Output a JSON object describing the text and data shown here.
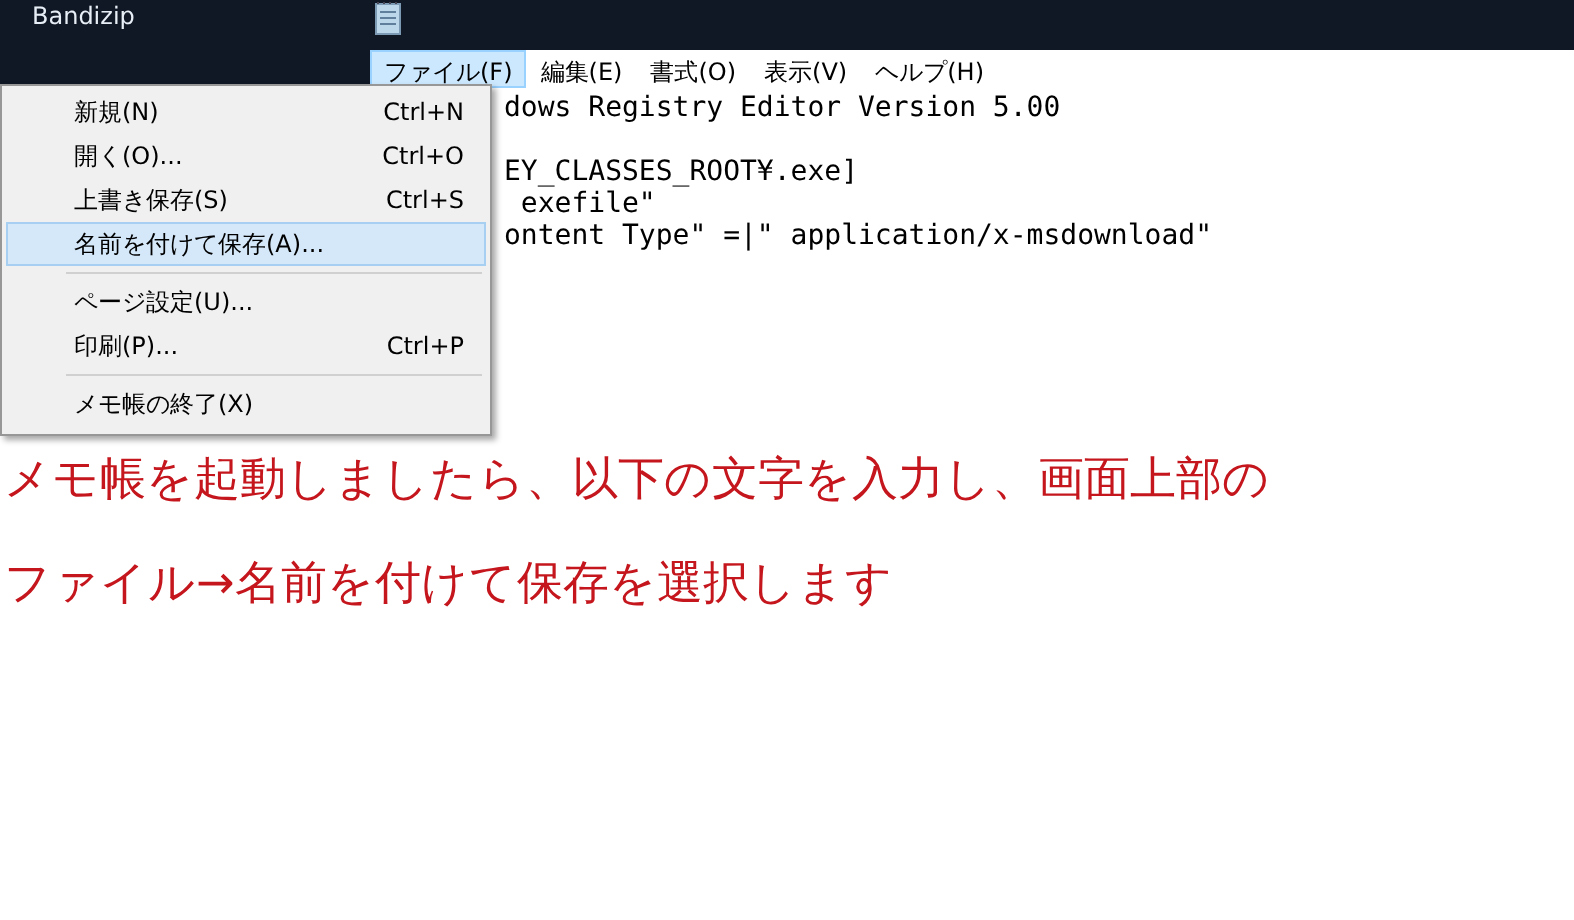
{
  "desktop": {
    "icon_label": "Bandizip"
  },
  "menu_bar": [
    {
      "label": "ファイル(F)",
      "selected": true
    },
    {
      "label": "編集(E)",
      "selected": false
    },
    {
      "label": "書式(O)",
      "selected": false
    },
    {
      "label": "表示(V)",
      "selected": false
    },
    {
      "label": "ヘルプ(H)",
      "selected": false
    }
  ],
  "editor_paragraphs": [
    [
      "dows Registry Editor Version 5.00"
    ],
    [
      "EY_CLASSES_ROOT¥.exe]",
      " exefile\"",
      "ontent Type\" =|\" application/x-msdownload\""
    ]
  ],
  "file_menu": [
    {
      "kind": "item",
      "label": "新規(N)",
      "shortcut": "Ctrl+N",
      "selected": false
    },
    {
      "kind": "item",
      "label": "開く(O)...",
      "shortcut": "Ctrl+O",
      "selected": false
    },
    {
      "kind": "item",
      "label": "上書き保存(S)",
      "shortcut": "Ctrl+S",
      "selected": false
    },
    {
      "kind": "item",
      "label": "名前を付けて保存(A)...",
      "selected": true
    },
    {
      "kind": "separator"
    },
    {
      "kind": "item",
      "label": "ページ設定(U)...",
      "selected": false
    },
    {
      "kind": "item",
      "label": "印刷(P)...",
      "shortcut": "Ctrl+P",
      "selected": false
    },
    {
      "kind": "separator"
    },
    {
      "kind": "item",
      "label": "メモ帳の終了(X)",
      "selected": false
    }
  ],
  "caption": [
    "メモ帳を起動しましたら、以下の文字を入力し、画面上部の",
    "ファイル→名前を付けて保存を選択します"
  ]
}
